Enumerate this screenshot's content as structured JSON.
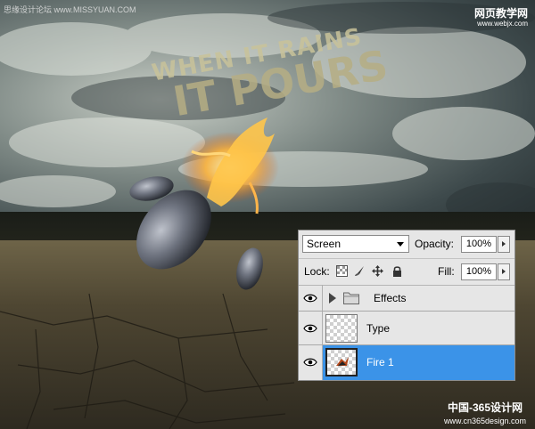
{
  "watermarks": {
    "top_left": "思缘设计论坛 www.MISSYUAN.COM",
    "top_right_title": "网页教学网",
    "top_right_url": "www.webjx.com",
    "bottom_right_title": "中国-365设计网",
    "bottom_right_url": "www.cn365design.com"
  },
  "artwork": {
    "headline_line1": "WHEN IT RAINS",
    "headline_line2": "IT POURS"
  },
  "layers_panel": {
    "blend_mode": "Screen",
    "opacity_label": "Opacity:",
    "opacity_value": "100%",
    "lock_label": "Lock:",
    "fill_label": "Fill:",
    "fill_value": "100%",
    "layers": [
      {
        "name": "Effects",
        "type": "group",
        "visible": true,
        "selected": false
      },
      {
        "name": "Type",
        "type": "layer",
        "visible": true,
        "selected": false
      },
      {
        "name": "Fire 1",
        "type": "layer",
        "visible": true,
        "selected": true
      }
    ]
  },
  "icons": {
    "visibility": "eye-icon",
    "group_expand": "triangle-right-icon",
    "group": "folder-icon",
    "lock_transparent": "lock-transparent-pixels-icon",
    "lock_image": "brush-icon",
    "lock_position": "move-icon",
    "lock_all": "padlock-icon"
  },
  "colors": {
    "panel_bg": "#e6e6e6",
    "selection": "#3b93e8"
  }
}
